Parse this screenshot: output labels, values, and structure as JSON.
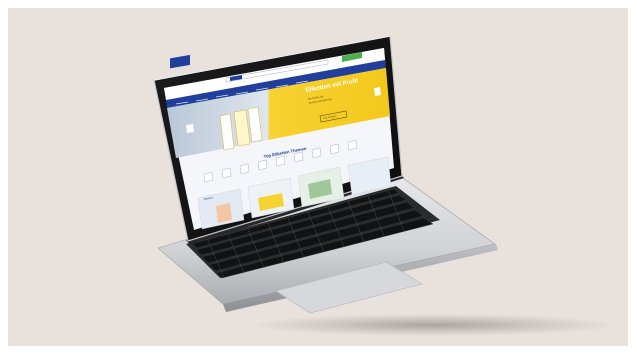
{
  "screen": {
    "logo_line1": "Etiketten",
    "logo_line2": "Rollen",
    "hero_title": "Etiketten mit Profil",
    "hero_line1": "Wir finden die ",
    "hero_line2": "für Ihre Anforderung",
    "hero_button": "Jetzt anfragen",
    "section_title": "Top Etiketten Themen",
    "card_title": "Etiketten"
  },
  "colors": {
    "background": "#e9e1db",
    "brand_blue": "#1f3f9a",
    "hero_yellow": "#f6d232",
    "accent_green": "#4caf50",
    "aluminium": "#cfd1d4"
  }
}
